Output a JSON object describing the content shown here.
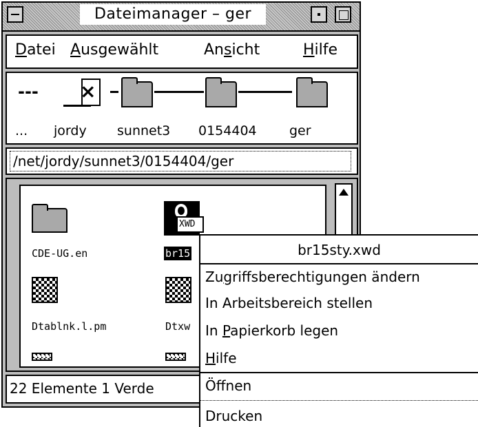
{
  "window": {
    "title": "Dateimanager – ger"
  },
  "menubar": {
    "items": [
      {
        "pre": "",
        "u": "D",
        "post": "atei"
      },
      {
        "pre": "",
        "u": "A",
        "post": "usgewählt"
      },
      {
        "pre": "An",
        "u": "s",
        "post": "icht"
      },
      {
        "pre": "",
        "u": "H",
        "post": "ilfe"
      }
    ]
  },
  "path_icons": {
    "ellipsis": "---",
    "labels": [
      "...",
      "jordy",
      "sunnet3",
      "0154404",
      "ger"
    ]
  },
  "path_field": {
    "value": "/net/jordy/sunnet3/0154404/ger"
  },
  "files": [
    {
      "name": "CDE-UG.en",
      "icon": "folder-icon"
    },
    {
      "name": "br15",
      "icon": "xwd-image-icon",
      "badge": "XWD"
    },
    {
      "name": "Dtablnk.l.pm",
      "icon": "pixmap-icon"
    },
    {
      "name": "Dtxw",
      "icon": "pixmap-icon"
    }
  ],
  "status": {
    "text": "22 Elemente 1 Verde"
  },
  "popup": {
    "title": "br15sty.xwd",
    "items": [
      {
        "pre": "Zu",
        "u": "g",
        "post": "riffsberechtigungen ändern"
      },
      {
        "pre": "In Arbeitsbereich stellen",
        "u": "",
        "post": ""
      },
      {
        "pre": "In ",
        "u": "P",
        "post": "apierkorb legen"
      },
      {
        "pre": "",
        "u": "H",
        "post": "ilfe"
      },
      {
        "pre": "Öffnen",
        "u": "",
        "post": ""
      },
      {
        "pre": "Drucken",
        "u": "",
        "post": ""
      }
    ]
  },
  "colors": {
    "window_bg": "#bdbdbd",
    "folder_fill": "#a9a9a9",
    "selection_bg": "#000000"
  }
}
